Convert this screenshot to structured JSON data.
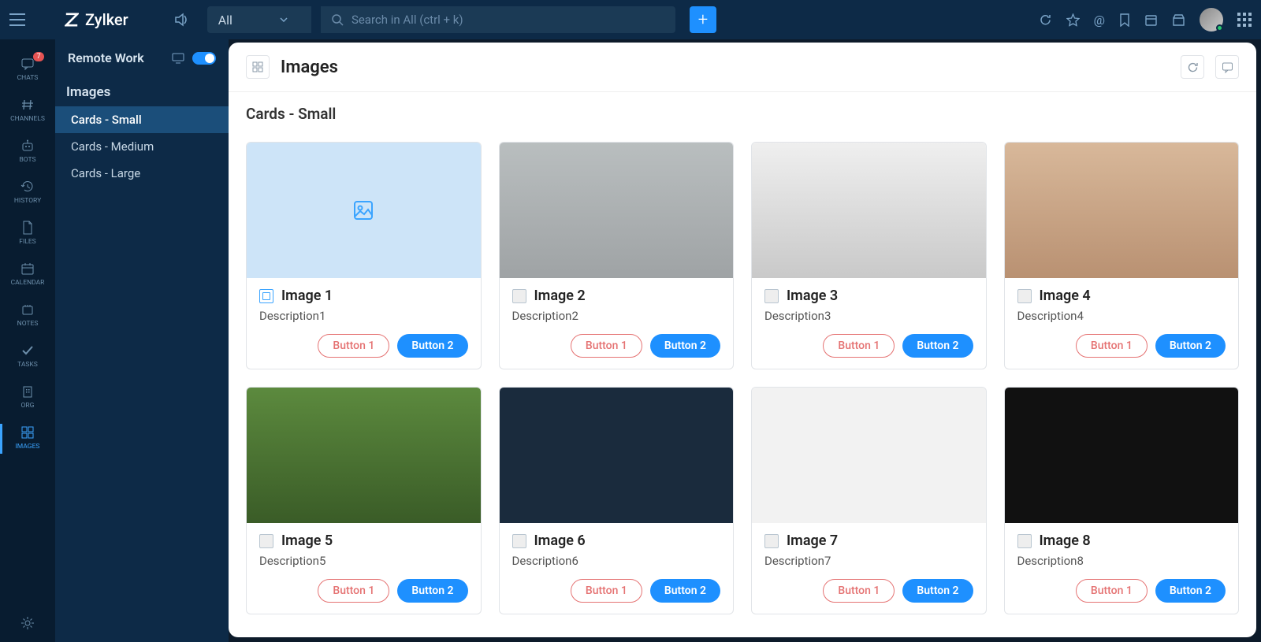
{
  "brand": "Zylker",
  "search": {
    "filter": "All",
    "placeholder": "Search in All (ctrl + k)"
  },
  "workspace": "Remote Work",
  "rail": [
    {
      "label": "CHATS",
      "icon": "chat",
      "badge": "7"
    },
    {
      "label": "CHANNELS",
      "icon": "hash"
    },
    {
      "label": "BOTS",
      "icon": "bot"
    },
    {
      "label": "HISTORY",
      "icon": "history"
    },
    {
      "label": "FILES",
      "icon": "file"
    },
    {
      "label": "CALENDAR",
      "icon": "calendar"
    },
    {
      "label": "NOTES",
      "icon": "notes"
    },
    {
      "label": "TASKS",
      "icon": "tasks"
    },
    {
      "label": "ORG",
      "icon": "org"
    },
    {
      "label": "IMAGES",
      "icon": "images",
      "active": true
    }
  ],
  "sidebar": {
    "section": "Images",
    "items": [
      {
        "label": "Cards - Small",
        "active": true
      },
      {
        "label": "Cards - Medium"
      },
      {
        "label": "Cards - Large"
      }
    ]
  },
  "page": {
    "title": "Images",
    "subtitle": "Cards - Small"
  },
  "button_labels": {
    "b1": "Button 1",
    "b2": "Button 2"
  },
  "cards": [
    {
      "title": "Image 1",
      "desc": "Description1",
      "placeholder": true
    },
    {
      "title": "Image 2",
      "desc": "Description2",
      "imgclass": "img-elephant"
    },
    {
      "title": "Image 3",
      "desc": "Description3",
      "imgclass": "img-turtle"
    },
    {
      "title": "Image 4",
      "desc": "Description4",
      "imgclass": "img-car"
    },
    {
      "title": "Image 5",
      "desc": "Description5",
      "imgclass": "img-squirrel"
    },
    {
      "title": "Image 6",
      "desc": "Description6",
      "imgclass": "img-chipmunk"
    },
    {
      "title": "Image 7",
      "desc": "Description7",
      "imgclass": "img-plants"
    },
    {
      "title": "Image 8",
      "desc": "Description8",
      "imgclass": "img-jellyfish"
    }
  ]
}
